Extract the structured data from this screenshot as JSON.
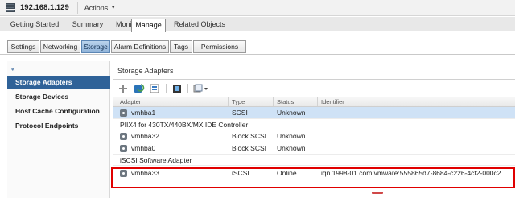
{
  "header": {
    "host": "192.168.1.129",
    "actions_label": "Actions"
  },
  "main_tabs": [
    {
      "label": "Getting Started",
      "active": false
    },
    {
      "label": "Summary",
      "active": false
    },
    {
      "label": "Monitor",
      "active": false
    },
    {
      "label": "Manage",
      "active": true
    },
    {
      "label": "Related Objects",
      "active": false
    }
  ],
  "sub_tabs": [
    {
      "label": "Settings",
      "active": false
    },
    {
      "label": "Networking",
      "active": false
    },
    {
      "label": "Storage",
      "active": true
    },
    {
      "label": "Alarm Definitions",
      "active": false
    },
    {
      "label": "Tags",
      "active": false
    },
    {
      "label": "Permissions",
      "active": false
    }
  ],
  "left_nav": {
    "collapse_glyph": "«",
    "items": [
      {
        "label": "Storage Adapters",
        "active": true
      },
      {
        "label": "Storage Devices",
        "active": false
      },
      {
        "label": "Host Cache Configuration",
        "active": false
      },
      {
        "label": "Protocol Endpoints",
        "active": false
      }
    ]
  },
  "content": {
    "title": "Storage Adapters",
    "toolbar_icons": [
      "add-icon",
      "refresh-icon",
      "rescan-icon",
      "properties-icon",
      "actions-dropdown-icon"
    ],
    "columns": [
      "Adapter",
      "Type",
      "Status",
      "Identifier"
    ],
    "rows": [
      {
        "kind": "row",
        "adapter": "vmhba1",
        "type": "SCSI",
        "status": "Unknown",
        "identifier": "",
        "selected": true
      },
      {
        "kind": "group",
        "label": "PIIX4 for 430TX/440BX/MX IDE Controller"
      },
      {
        "kind": "row",
        "adapter": "vmhba32",
        "type": "Block SCSI",
        "status": "Unknown",
        "identifier": "",
        "selected": false
      },
      {
        "kind": "row",
        "adapter": "vmhba0",
        "type": "Block SCSI",
        "status": "Unknown",
        "identifier": "",
        "selected": false
      },
      {
        "kind": "group",
        "label": "iSCSI Software Adapter"
      },
      {
        "kind": "row",
        "adapter": "vmhba33",
        "type": "iSCSI",
        "status": "Online",
        "identifier": "iqn.1998-01.com.vmware:555865d7-8684-c226-4cf2-000c2",
        "selected": false
      }
    ]
  },
  "colors": {
    "accent": "#2f6298",
    "highlight_border": "#e00000",
    "selected_row": "#cfe2f6"
  }
}
